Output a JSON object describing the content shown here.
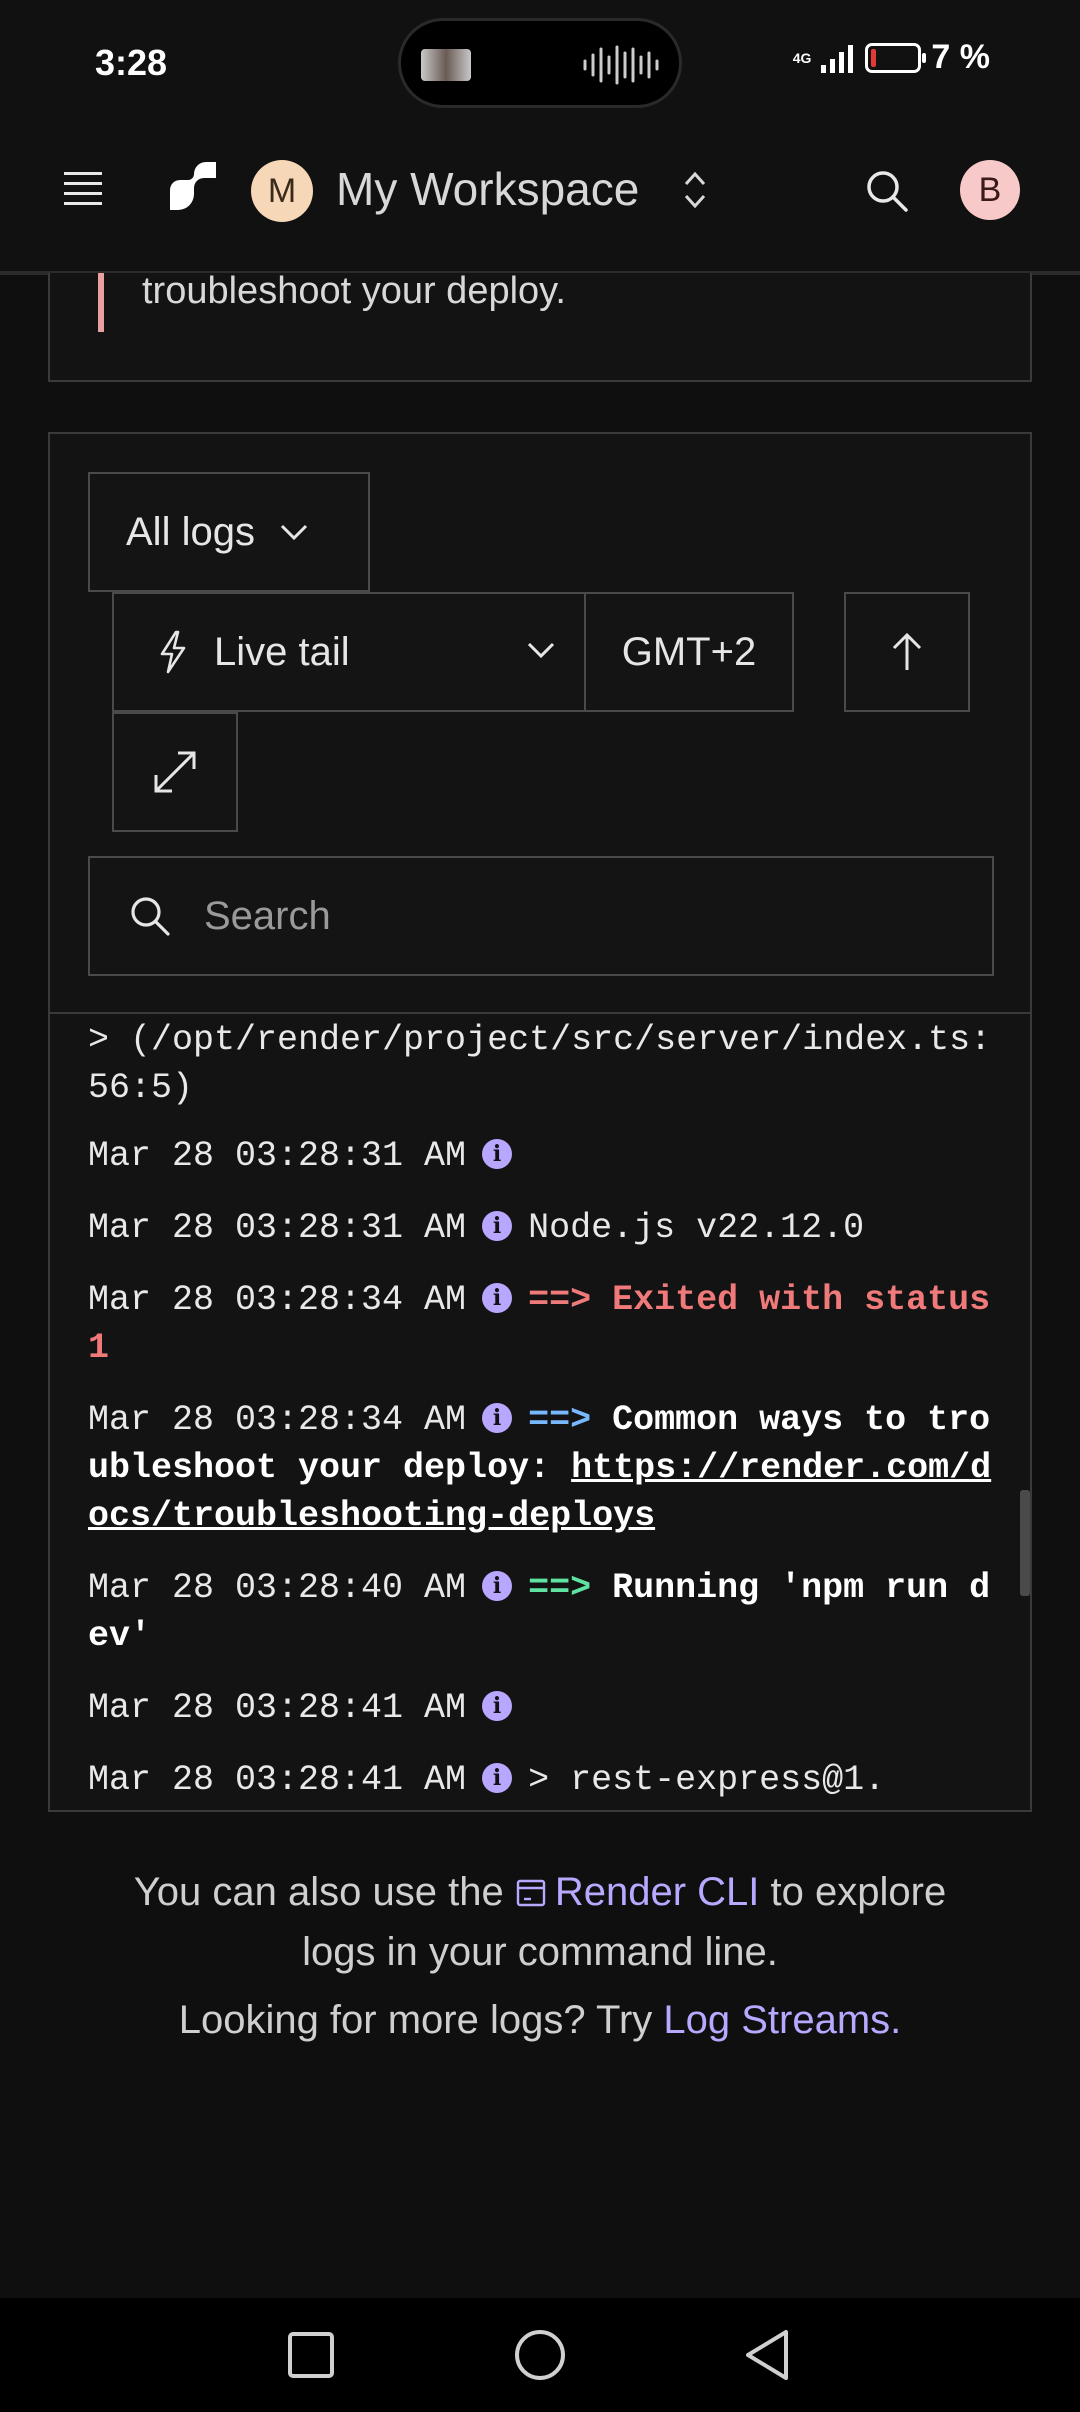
{
  "status_bar": {
    "time": "3:28",
    "network": "4G",
    "battery": "7 %"
  },
  "header": {
    "workspace_initial": "M",
    "workspace_name": "My Workspace",
    "user_initial": "B"
  },
  "alert": {
    "text": "troubleshoot your deploy."
  },
  "logs_toolbar": {
    "filter_label": "All logs",
    "mode_label": "Live tail",
    "timezone_label": "GMT+2",
    "search_placeholder": "Search"
  },
  "logs": [
    {
      "text": "> (/opt/render/project/src/server/index.ts:56:5)"
    },
    {
      "timestamp": "Mar 28 03:28:31 AM",
      "message": ""
    },
    {
      "timestamp": "Mar 28 03:28:31 AM",
      "message": "Node.js v22.12.0"
    },
    {
      "timestamp": "Mar 28 03:28:34 AM",
      "arrow": "==>",
      "message": "Exited with status 1"
    },
    {
      "timestamp": "Mar 28 03:28:34 AM",
      "arrow": "==>",
      "message": "Common ways to troubleshoot your deploy: ",
      "link": "https://render.com/docs/troubleshooting-deploys"
    },
    {
      "timestamp": "Mar 28 03:28:40 AM",
      "arrow": "==>",
      "message": "Running 'npm run dev'"
    },
    {
      "timestamp": "Mar 28 03:28:41 AM",
      "message": ""
    },
    {
      "timestamp": "Mar 28 03:28:41 AM",
      "message": "> rest-express@1."
    }
  ],
  "footer": {
    "cli_prefix": "You can also use the",
    "cli_link": "Render CLI",
    "cli_suffix": "to explore",
    "cli_line2": "logs in your command line.",
    "streams_prefix": "Looking for more logs? Try",
    "streams_link": "Log Streams."
  },
  "colors": {
    "background": "#0f0f0f",
    "accent_purple": "#b8a8ff",
    "error_red": "#f07a7a",
    "info_blue": "#78b8ff",
    "success_green": "#5fe3a1"
  }
}
